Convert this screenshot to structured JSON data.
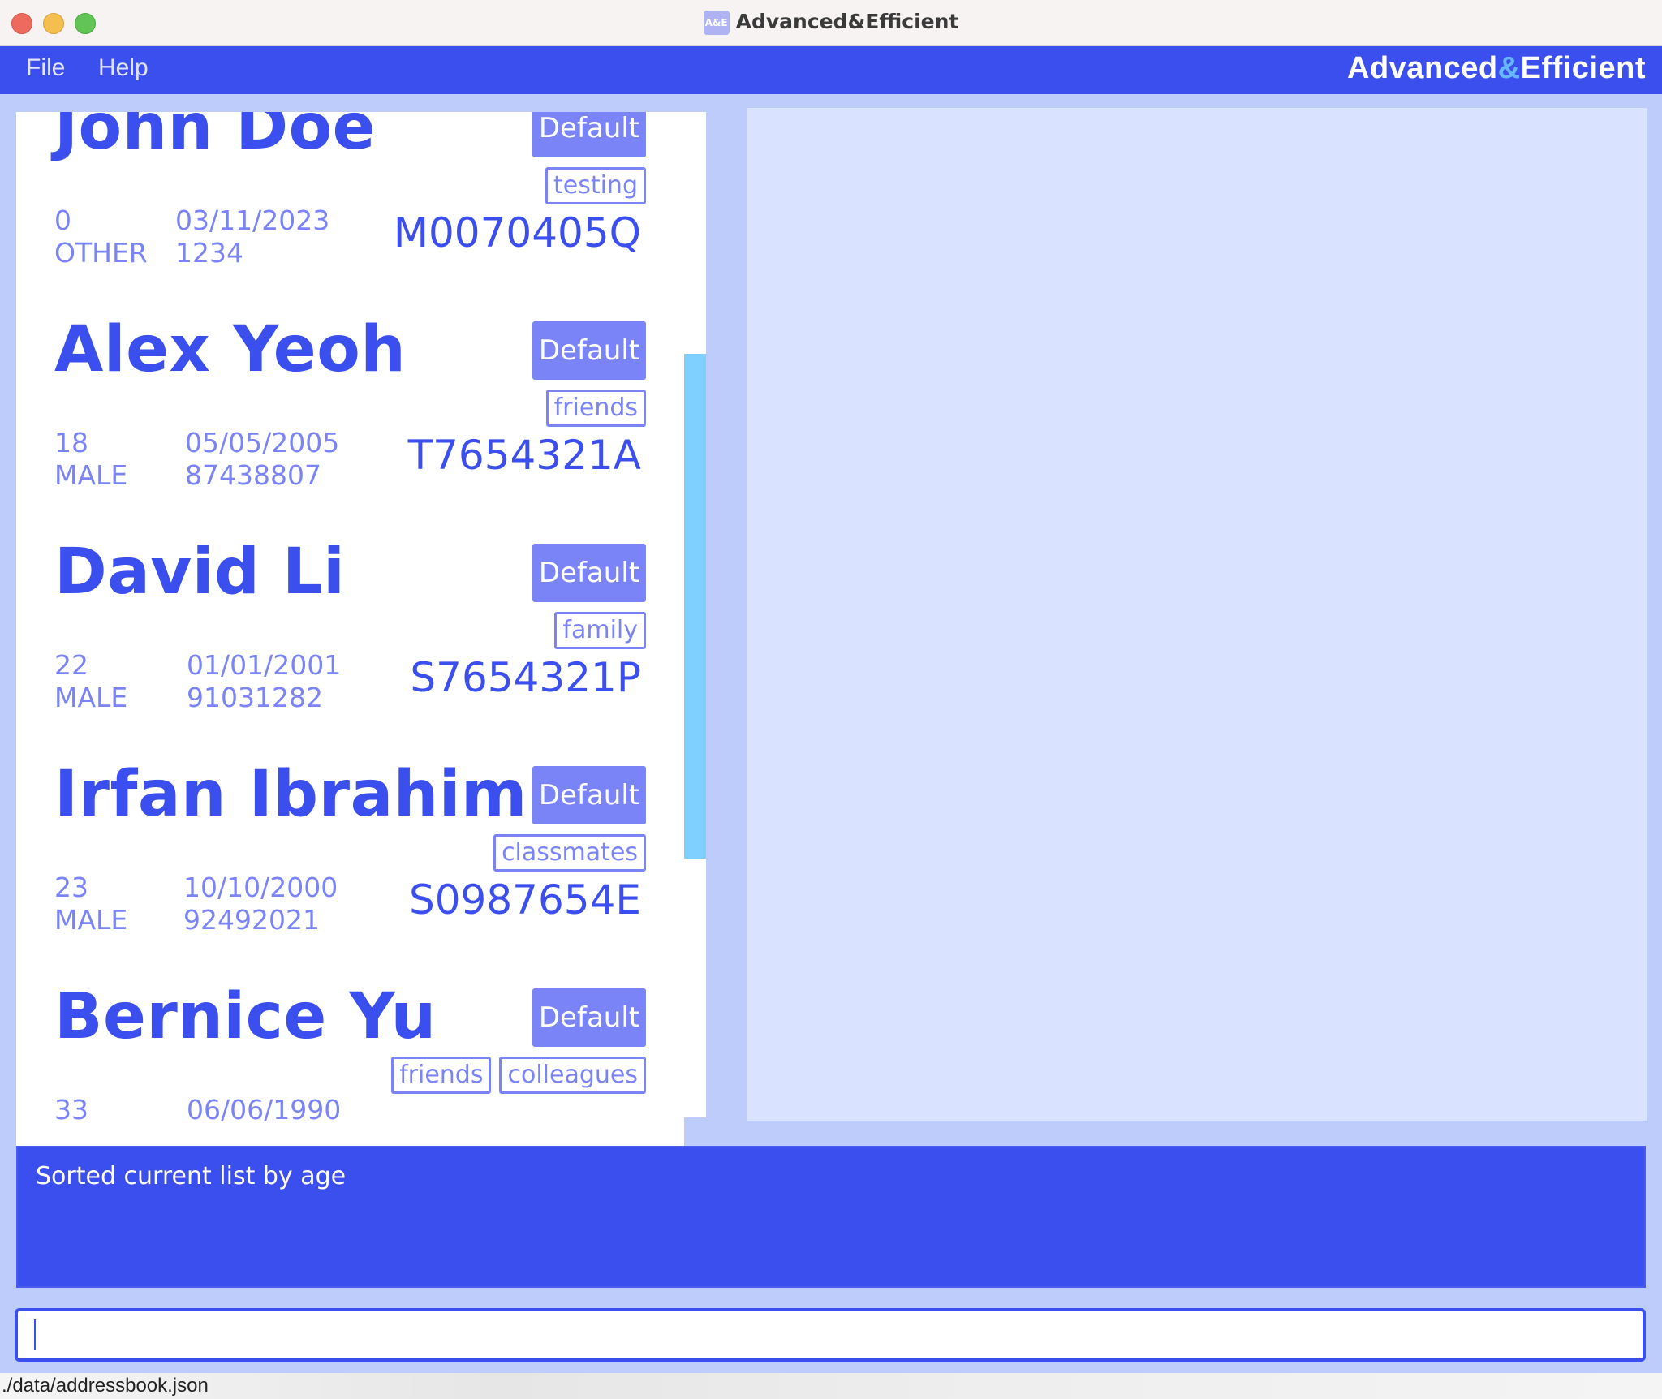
{
  "window": {
    "title": "Advanced&Efficient",
    "icon_label": "A&E"
  },
  "menu": {
    "file": "File",
    "help": "Help"
  },
  "brand": {
    "part1": "Advanced",
    "amp": "&",
    "part2": "Efficient"
  },
  "persons": [
    {
      "name": "John Doe",
      "priority": "Default",
      "tags": [
        "testing"
      ],
      "age": "0",
      "gender": "OTHER",
      "dob": "03/11/2023",
      "phone": "1234",
      "nric": "M0070405Q"
    },
    {
      "name": "Alex Yeoh",
      "priority": "Default",
      "tags": [
        "friends"
      ],
      "age": "18",
      "gender": "MALE",
      "dob": "05/05/2005",
      "phone": "87438807",
      "nric": "T7654321A"
    },
    {
      "name": "David Li",
      "priority": "Default",
      "tags": [
        "family"
      ],
      "age": "22",
      "gender": "MALE",
      "dob": "01/01/2001",
      "phone": "91031282",
      "nric": "S7654321P"
    },
    {
      "name": "Irfan Ibrahim",
      "priority": "Default",
      "tags": [
        "classmates"
      ],
      "age": "23",
      "gender": "MALE",
      "dob": "10/10/2000",
      "phone": "92492021",
      "nric": "S0987654E"
    },
    {
      "name": "Bernice Yu",
      "priority": "Default",
      "tags": [
        "friends",
        "colleagues"
      ],
      "age": "33",
      "gender": "",
      "dob": "06/06/1990",
      "phone": "",
      "nric": ""
    }
  ],
  "result": {
    "message": "Sorted current list by age"
  },
  "command": {
    "value": "",
    "placeholder": ""
  },
  "status": {
    "path": "./data/addressbook.json"
  },
  "colors": {
    "primary": "#3b4eee",
    "accent": "#7b84f6",
    "background": "#bdccfb",
    "detail_panel": "#d9e2fe",
    "scroll_thumb": "#7fd0ff"
  }
}
